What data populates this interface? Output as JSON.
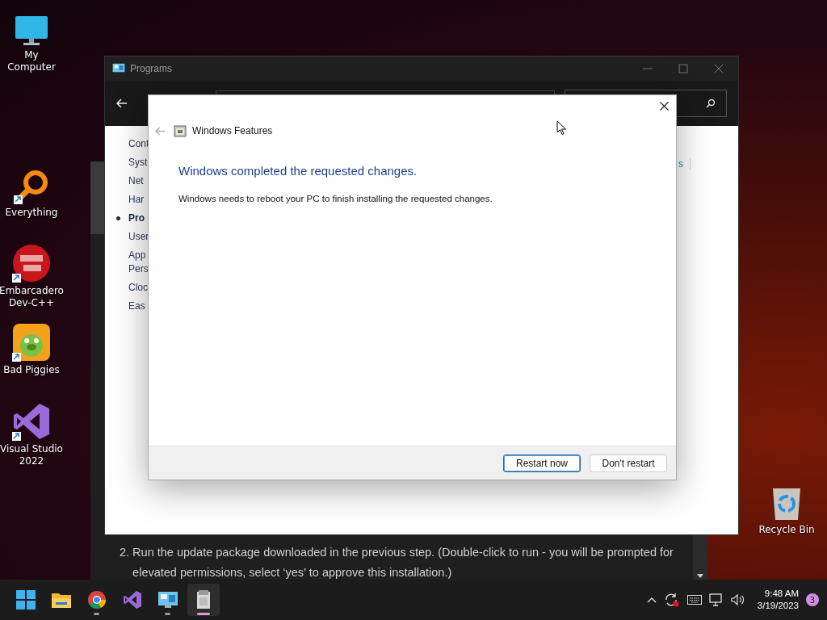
{
  "desktop_icons": [
    {
      "kind": "computer",
      "label": "My Computer",
      "shortcut": false
    },
    {
      "kind": "search",
      "label": "Everything",
      "shortcut": true
    },
    {
      "kind": "devcpp",
      "label": "Embarcadero Dev-C++",
      "shortcut": true
    },
    {
      "kind": "piggy",
      "label": "Bad Piggies",
      "shortcut": true
    },
    {
      "kind": "vs",
      "label": "Visual Studio 2022",
      "shortcut": true
    },
    {
      "kind": "recycle",
      "label": "Recycle Bin",
      "shortcut": false
    }
  ],
  "browser_page": {
    "step_number": "2.",
    "step_text": "Run the update package downloaded in the previous step. (Double-click to run - you will be prompted for elevated permissions, select ‘yes’ to approve this installation.)"
  },
  "programs_window": {
    "title": "Programs",
    "nav_items": [
      {
        "lines": [
          "Cont"
        ],
        "selected": false
      },
      {
        "lines": [
          "Syst"
        ],
        "selected": false
      },
      {
        "lines": [
          "Net"
        ],
        "selected": false
      },
      {
        "lines": [
          "Har"
        ],
        "selected": false
      },
      {
        "lines": [
          "Pro"
        ],
        "selected": true
      },
      {
        "lines": [
          "User"
        ],
        "selected": false
      },
      {
        "lines": [
          "App",
          "Pers"
        ],
        "selected": false
      },
      {
        "lines": [
          "Cloc"
        ],
        "selected": false
      },
      {
        "lines": [
          "Eas"
        ],
        "selected": false
      }
    ],
    "right_link": "s"
  },
  "dialog": {
    "title": "Windows Features",
    "heading": "Windows completed the requested changes.",
    "message": "Windows needs to reboot your PC to finish installing the requested changes.",
    "buttons": [
      {
        "label": "Restart now",
        "default": true
      },
      {
        "label": "Don't restart",
        "default": false
      }
    ]
  },
  "taskbar": {
    "apps": [
      {
        "kind": "start",
        "running": false,
        "selected": false
      },
      {
        "kind": "explorer",
        "running": false,
        "selected": false
      },
      {
        "kind": "chrome",
        "running": true,
        "selected": false
      },
      {
        "kind": "vs",
        "running": false,
        "selected": false
      },
      {
        "kind": "control",
        "running": true,
        "selected": false
      },
      {
        "kind": "features",
        "running": true,
        "selected": true
      }
    ],
    "time": "9:48 AM",
    "date": "3/19/2023",
    "notifications": "3"
  }
}
